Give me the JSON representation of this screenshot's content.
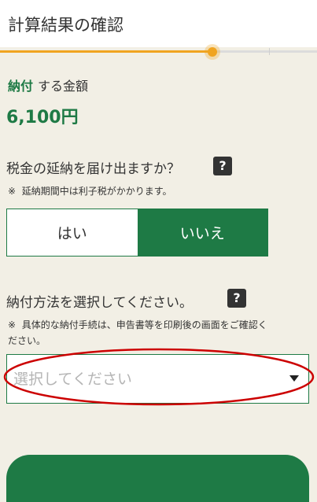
{
  "header": {
    "title": "計算結果の確認"
  },
  "progress": {
    "value": 0.67,
    "color": "#f0a420"
  },
  "amount": {
    "label_bold": "納付",
    "label_rest": "する金額",
    "value": "6,100円"
  },
  "deferral": {
    "question": "税金の延納を届け出ますか？",
    "help_label": "?",
    "note_mark": "※",
    "note": "延納期間中は利子税がかかります。",
    "options": [
      "はい",
      "いいえ"
    ],
    "selected": "いいえ"
  },
  "payment": {
    "question": "納付方法を選択してください。",
    "help_label": "?",
    "note_mark": "※",
    "note_line1": "具体的な納付手続は、申告書等を印刷後の画面をご確認く",
    "note_line2": "ださい。",
    "placeholder": "選択してください"
  },
  "colors": {
    "accent": "#1e7a45",
    "background": "#f2efe5",
    "annotation": "#cc0000"
  }
}
